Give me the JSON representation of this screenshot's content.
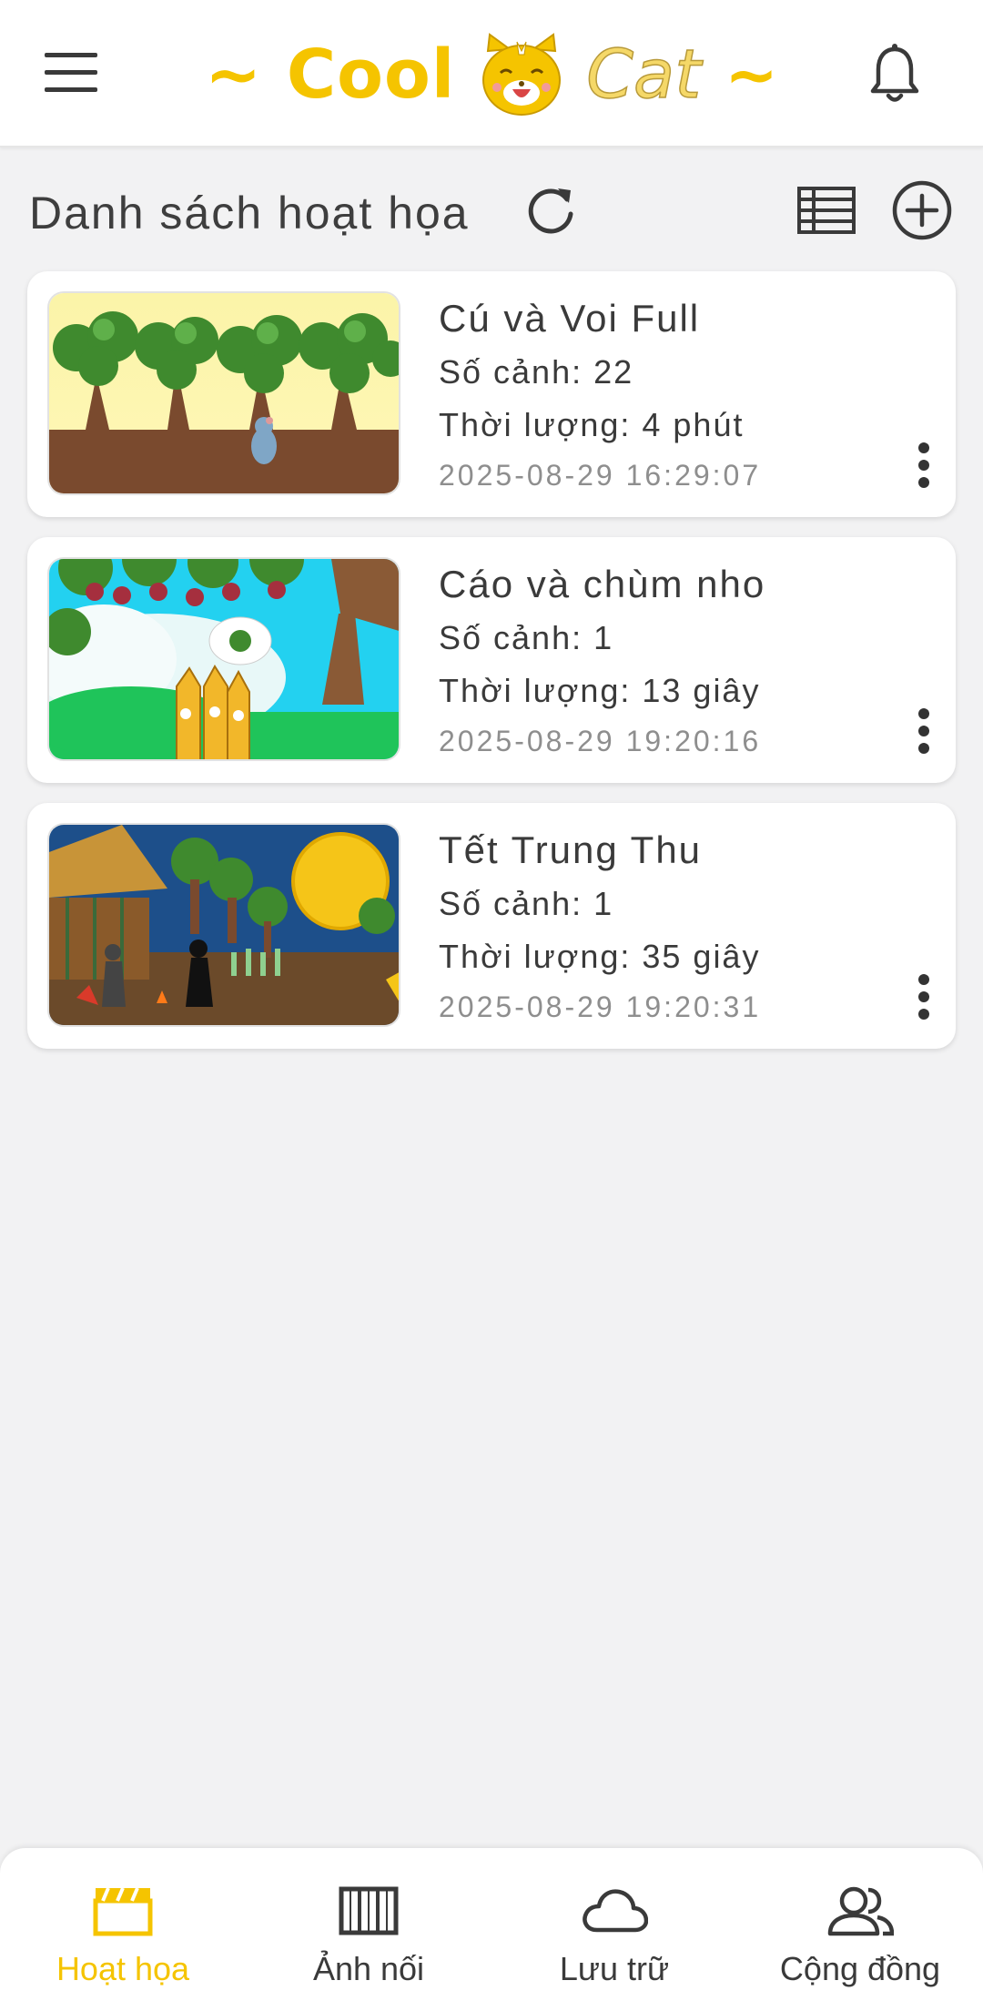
{
  "app": {
    "logo_prefix": "~ Cool",
    "logo_suffix": "Cat",
    "logo_tilde": "~",
    "brand_color": "#f5c400"
  },
  "icons": {
    "menu": "hamburger-menu-icon",
    "notifications": "bell-icon",
    "refresh": "refresh-icon",
    "view_list": "list-view-icon",
    "add": "add-circle-icon",
    "more": "more-vert-icon"
  },
  "header": {
    "title": "Danh sách hoạt họa"
  },
  "animations": [
    {
      "title": "Cú và Voi Full",
      "scenes": "Số cảnh: 22",
      "duration": "Thời lượng: 4 phút",
      "date": "2025-08-29 16:29:07"
    },
    {
      "title": "Cáo và chùm nho",
      "scenes": "Số cảnh: 1",
      "duration": "Thời lượng: 13 giây",
      "date": "2025-08-29 19:20:16"
    },
    {
      "title": "Tết Trung Thu",
      "scenes": "Số cảnh: 1",
      "duration": "Thời lượng: 35 giây",
      "date": "2025-08-29 19:20:31"
    }
  ],
  "bottom_nav": [
    {
      "label": "Hoạt họa",
      "icon": "clapperboard-icon",
      "active": true
    },
    {
      "label": "Ảnh nối",
      "icon": "film-strip-icon",
      "active": false
    },
    {
      "label": "Lưu trữ",
      "icon": "cloud-icon",
      "active": false
    },
    {
      "label": "Cộng đồng",
      "icon": "community-icon",
      "active": false
    }
  ]
}
